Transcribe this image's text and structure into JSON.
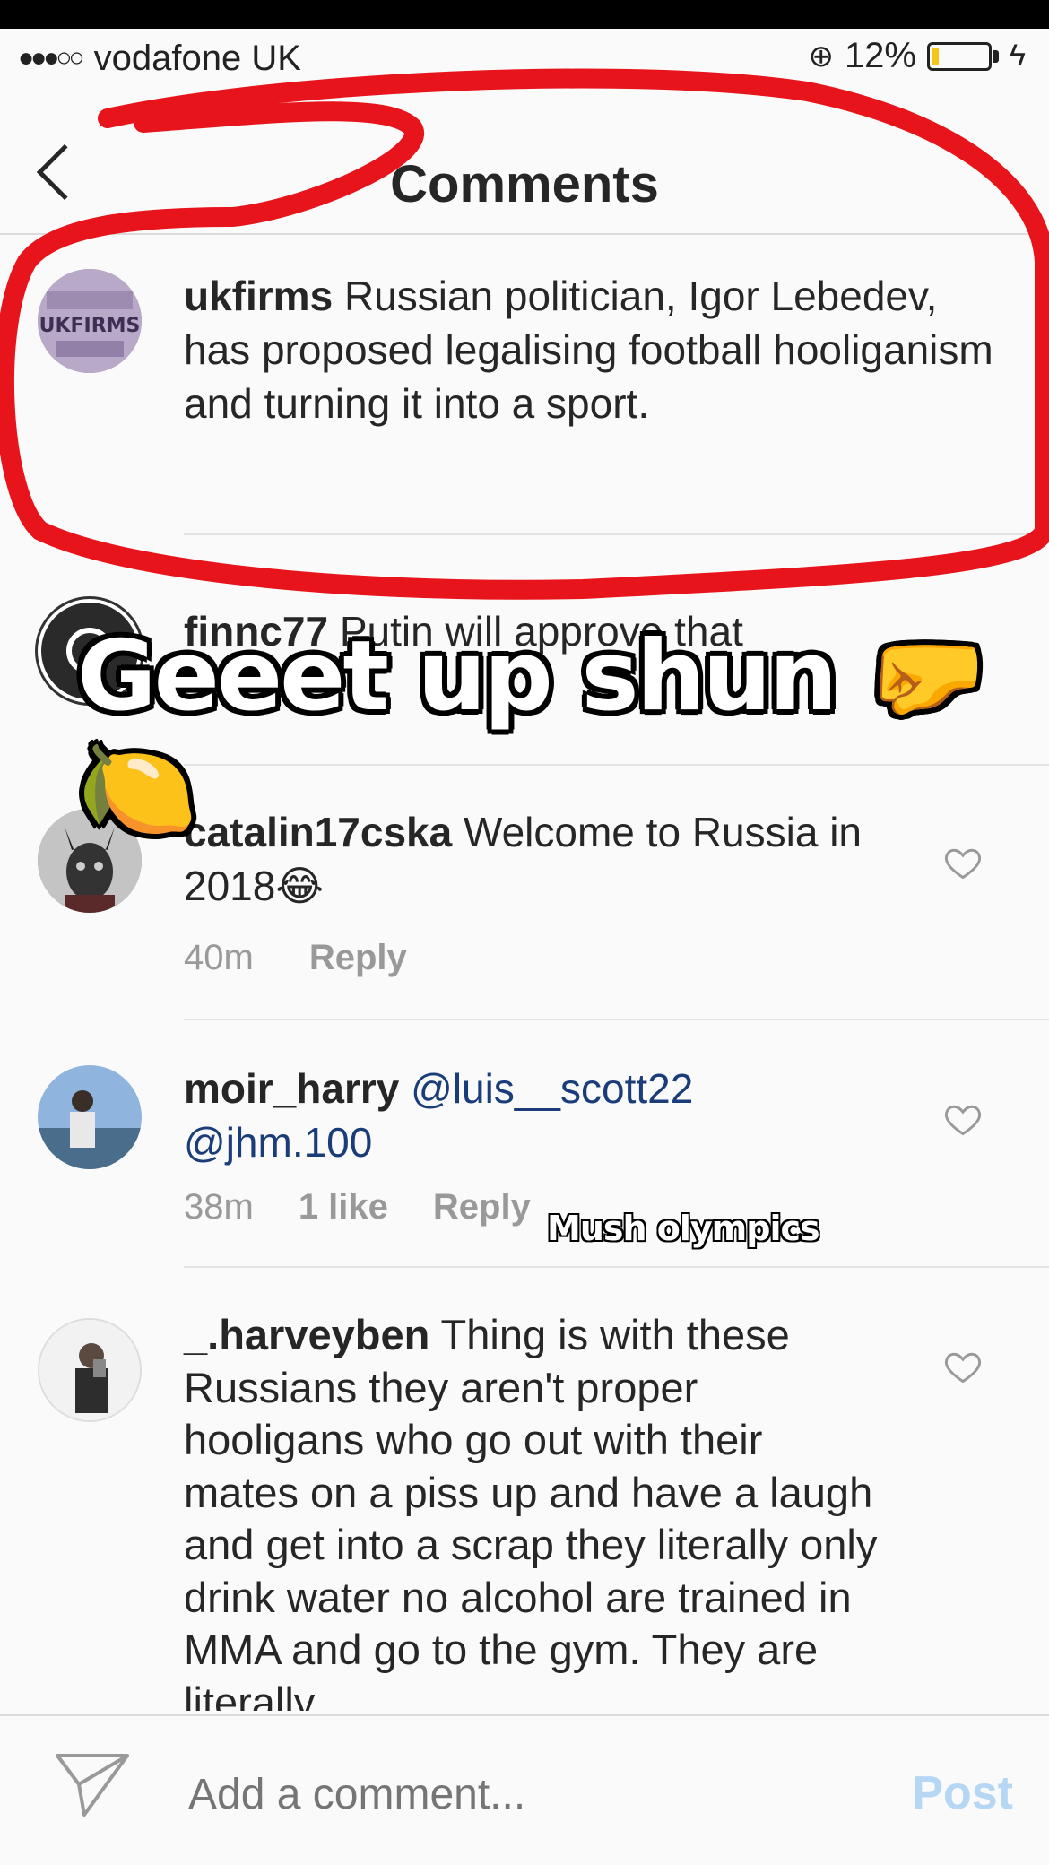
{
  "status_bar": {
    "signal": "●●●○○",
    "carrier": "vodafone UK",
    "battery_percent": "12%",
    "battery_level": 0.12,
    "charging_icon": "bolt-icon"
  },
  "nav": {
    "title": "Comments",
    "back_icon": "chevron-left-icon"
  },
  "comments": [
    {
      "username": "ukfirms",
      "text": "Russian politician, Igor Lebedev, has proposed legalising football hooliganism and turning it into a sport.",
      "avatar_text": "UKFIRMS"
    },
    {
      "username": "finnc77",
      "text": "Putin will approve that"
    },
    {
      "username": "catalin17cska",
      "text": "Welcome to Russia in 2018😂",
      "time": "40m",
      "reply": "Reply"
    },
    {
      "username": "moir_harry",
      "text": "@luis__scott22 @jhm.100",
      "time": "38m",
      "likes": "1 like",
      "reply": "Reply"
    },
    {
      "username": "_.harveyben",
      "text": "Thing is with these Russians they aren't proper hooligans who go out with their mates on a piss up and have a laugh and get into a scrap they literally only drink water no alcohol are trained in MMA and go to the gym. They are literally"
    }
  ],
  "overlay": {
    "caption": "Geeet up shun 🤛🍋",
    "sub_caption": "Mush olympics",
    "annotation_color": "#e8141b"
  },
  "compose": {
    "placeholder": "Add a comment...",
    "post_label": "Post"
  }
}
